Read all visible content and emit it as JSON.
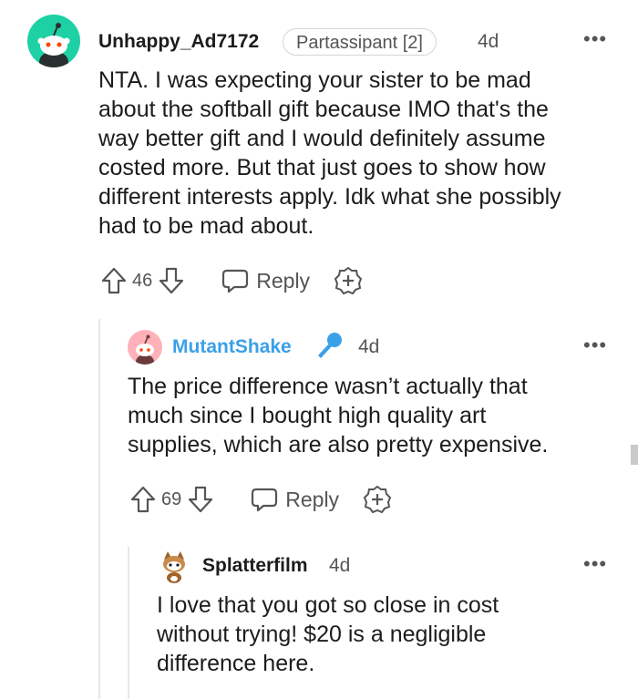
{
  "comments": [
    {
      "username": "Unhappy_Ad7172",
      "flair": "Partassipant [2]",
      "time": "4d",
      "more": "•••",
      "body": [
        "NTA. I was expecting your sister to be mad",
        "about the softball gift because IMO that's the",
        "way better gift and I would definitely assume",
        "costed more. But that just goes to show how",
        "different interests apply. Idk what she possibly",
        "had to be mad about."
      ],
      "votes": "46",
      "reply_label": "Reply",
      "avatar_color": "#1ed1a4"
    },
    {
      "username": "MutantShake",
      "time": "4d",
      "more": "•••",
      "body": [
        "The price difference wasn’t actually that",
        "much since I bought high quality art",
        "supplies, which are also pretty expensive."
      ],
      "votes": "69",
      "reply_label": "Reply",
      "avatar_color": "#ffb1ba",
      "username_color": "#3aa0e8",
      "badge_icon": "microphone-icon"
    },
    {
      "username": "Splatterfilm",
      "time": "4d",
      "more": "•••",
      "body": [
        "I love that you got so close in cost",
        "without trying! $20 is a negligible",
        "difference here."
      ]
    }
  ]
}
